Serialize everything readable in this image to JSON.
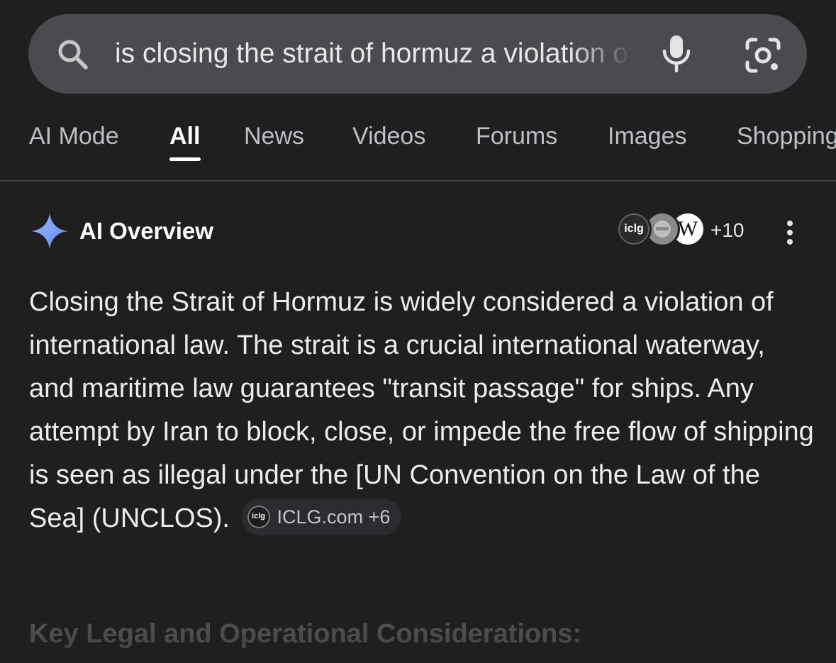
{
  "search": {
    "query": "is closing the strait of hormuz a violation of international law"
  },
  "tabs": [
    {
      "label": "AI Mode",
      "active": false
    },
    {
      "label": "All",
      "active": true
    },
    {
      "label": "News",
      "active": false
    },
    {
      "label": "Videos",
      "active": false
    },
    {
      "label": "Forums",
      "active": false
    },
    {
      "label": "Images",
      "active": false
    },
    {
      "label": "Shopping",
      "active": false
    }
  ],
  "ai_overview": {
    "title": "AI Overview",
    "sources": {
      "favicons": [
        {
          "label": "iclg",
          "icon": "iclg-logo"
        },
        {
          "label": "",
          "icon": "gray-site-logo"
        },
        {
          "label": "W",
          "icon": "wikipedia-logo"
        }
      ],
      "more_count": "+10"
    },
    "body": "Closing the Strait of Hormuz is widely considered a violation of international law. The strait is a crucial international waterway, and maritime law guarantees \"transit passage\" for ships. Any attempt by Iran to block, close, or impede the free flow of shipping is seen as illegal under the [UN Convention on the Law of the Sea] (UNCLOS).",
    "citation": {
      "logo_label": "iclg",
      "label": "ICLG.com +6"
    },
    "section_heading": "Key Legal and Operational Considerations:"
  },
  "colors": {
    "background": "#1f1f1f",
    "search_bar": "#4a4b4e",
    "sparkle": "#7da2f6"
  }
}
